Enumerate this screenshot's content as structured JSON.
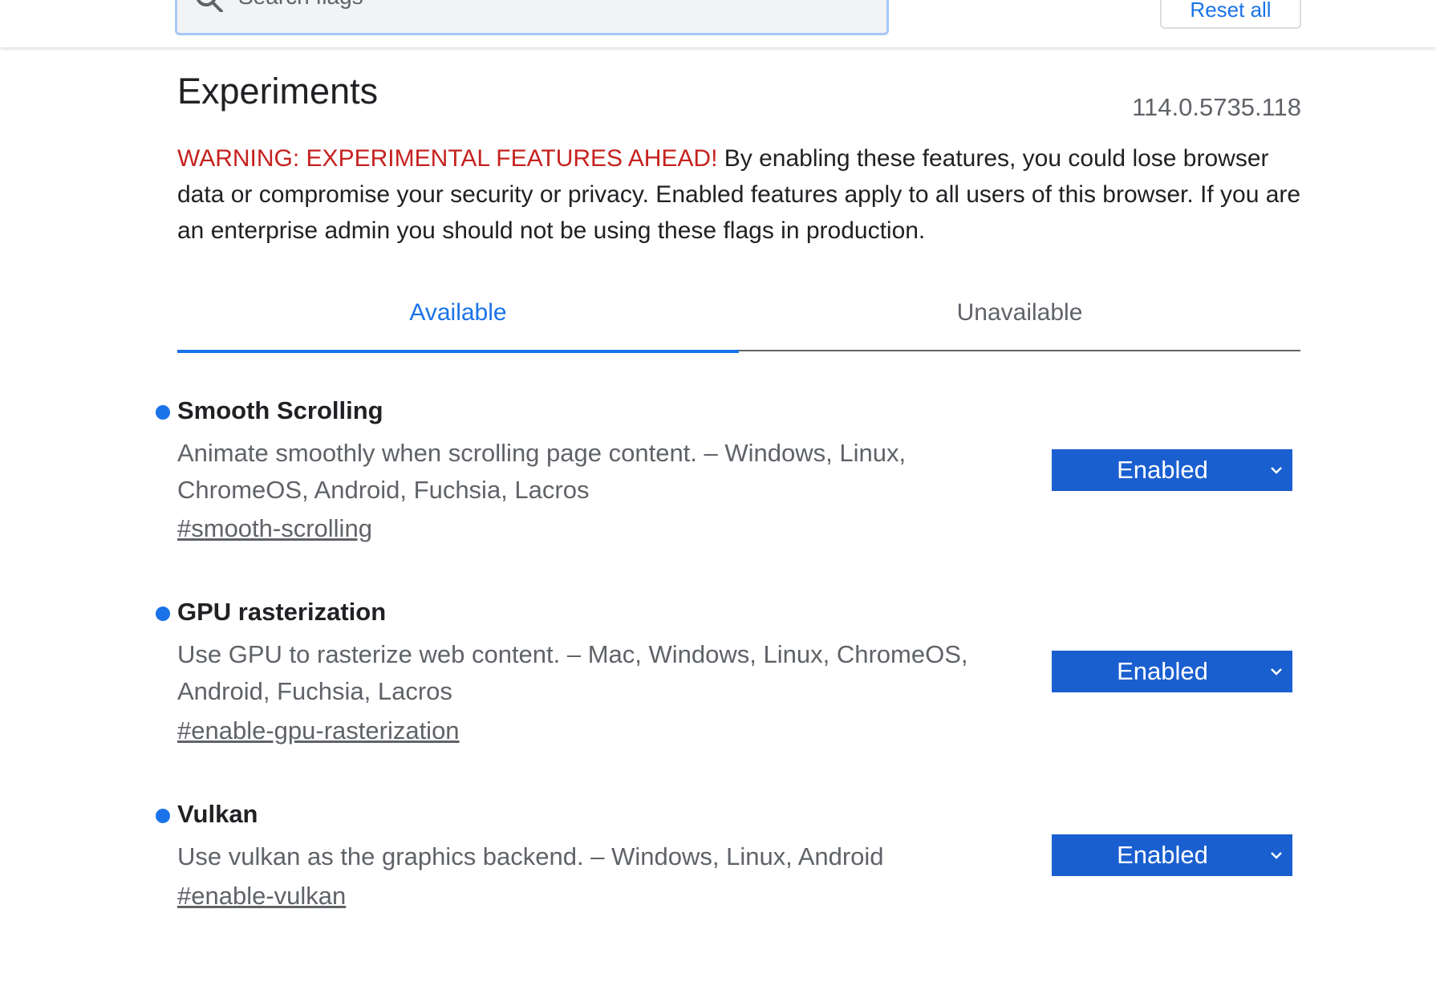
{
  "search": {
    "placeholder": "Search flags"
  },
  "toolbar": {
    "reset_label": "Reset all"
  },
  "page": {
    "title": "Experiments",
    "version": "114.0.5735.118"
  },
  "warning": {
    "prefix": "WARNING: EXPERIMENTAL FEATURES AHEAD!",
    "body": " By enabling these features, you could lose browser data or compromise your security or privacy. Enabled features apply to all users of this browser. If you are an enterprise admin you should not be using these flags in production."
  },
  "tabs": [
    {
      "label": "Available",
      "active": true
    },
    {
      "label": "Unavailable",
      "active": false
    }
  ],
  "flags": [
    {
      "title": "Smooth Scrolling",
      "description": "Animate smoothly when scrolling page content. – Windows, Linux, ChromeOS, Android, Fuchsia, Lacros",
      "link": "#smooth-scrolling",
      "value": "Enabled"
    },
    {
      "title": "GPU rasterization",
      "description": "Use GPU to rasterize web content. – Mac, Windows, Linux, ChromeOS, Android, Fuchsia, Lacros",
      "link": "#enable-gpu-rasterization",
      "value": "Enabled"
    },
    {
      "title": "Vulkan",
      "description": "Use vulkan as the graphics backend. – Windows, Linux, Android",
      "link": "#enable-vulkan",
      "value": "Enabled"
    }
  ],
  "colors": {
    "accent": "#1a73e8",
    "select_bg": "#1a5fd0",
    "warning": "#c5221f",
    "secondary_text": "#5f6368"
  },
  "icons": {
    "search": "search-icon",
    "dropdown": "chevron-down-icon",
    "modified_marker": "modified-dot-icon"
  }
}
